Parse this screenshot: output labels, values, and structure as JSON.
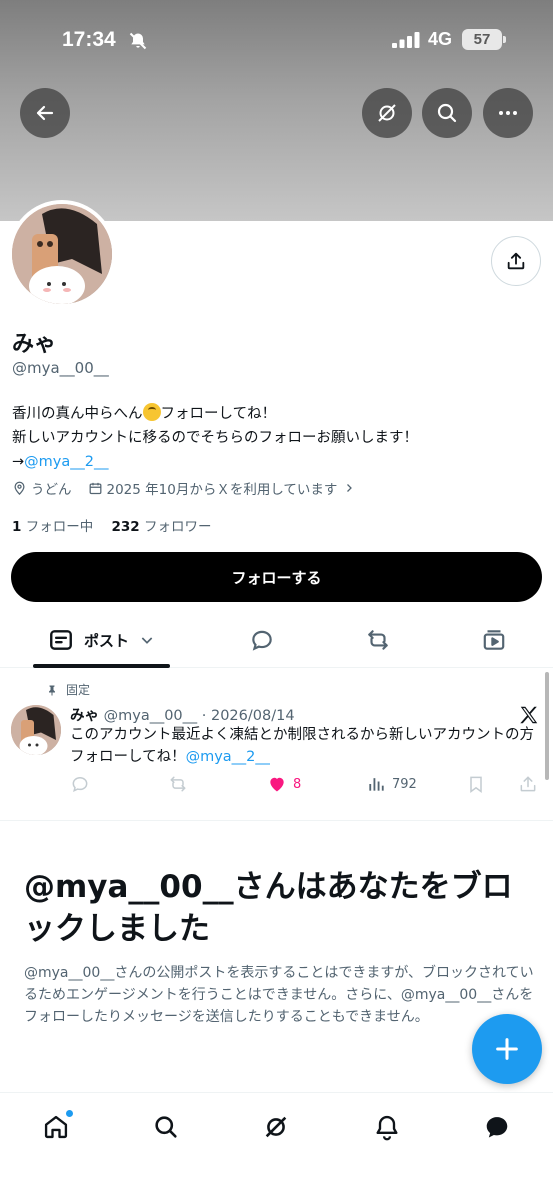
{
  "status_bar": {
    "time": "17:34",
    "network": "4G",
    "battery": "57",
    "icons": [
      "bell-slash-icon",
      "signal-icon"
    ]
  },
  "header_buttons": {
    "back_icon": "arrow-left-icon",
    "grok_icon": "grok-icon",
    "search_icon": "search-icon",
    "more_icon": "more-icon",
    "share_icon": "share-icon"
  },
  "profile": {
    "display_name": "みゃ",
    "handle": "@mya__00__",
    "bio_line1_a": "香川の真ん中らへん",
    "bio_line1_b": "フォローしてね！",
    "bio_line2": "新しいアカウントに移るのでそちらのフォローお願いします！",
    "bio_line3_arrow": "→",
    "bio_line3_link": "@mya__2__",
    "location": "うどん",
    "joined": "2025 年10月からＸを利用しています",
    "following_count": "1",
    "following_label": "フォロー中",
    "followers_count": "232",
    "followers_label": "フォロワー",
    "follow_button": "フォローする"
  },
  "tabs": {
    "posts_label": "ポスト",
    "items": [
      "posts-icon",
      "replies-icon",
      "reposts-icon",
      "media-icon"
    ]
  },
  "pinned_post": {
    "pinned_label": "固定",
    "author": "みゃ",
    "handle": "@mya__00__",
    "separator": "·",
    "date": "2026/08/14",
    "text": "このアカウント最近よく凍結とか制限されるから新しいアカウントの方フォローしてね！",
    "mention": "@mya__2__",
    "likes": "8",
    "views": "792",
    "liked": true
  },
  "blocked_notice": {
    "title": "@mya__00__さんはあなたをブロックしました",
    "body": "@mya__00__さんの公開ポストを表示することはできますが、ブロックされているためエンゲージメントを行うことはできません。さらに、@mya__00__さんをフォローしたりメッセージを送信したりすることもできません。"
  },
  "colors": {
    "accent": "#1d9bf0",
    "like": "#f91880",
    "text": "#0f1419",
    "muted": "#536471"
  },
  "bottom_nav": [
    "home-icon",
    "search-icon",
    "grok-icon",
    "notifications-icon",
    "messages-icon"
  ]
}
